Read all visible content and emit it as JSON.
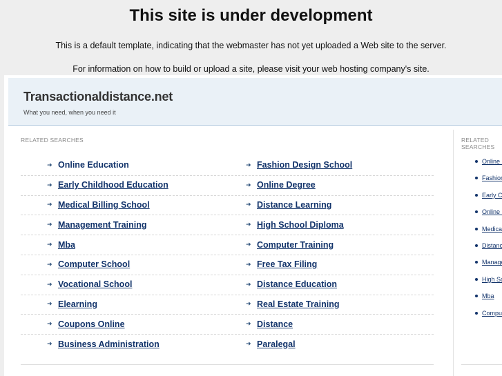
{
  "banner": {
    "title": "This site is under development",
    "line1": "This is a default template, indicating that the webmaster has not yet uploaded a Web site to the server.",
    "line2": "For information on how to build or upload a site, please visit your web hosting company's site."
  },
  "site": {
    "name": "Transactionaldistance.net",
    "tagline": "What you need, when you need it"
  },
  "related": {
    "label": "RELATED SEARCHES",
    "side_label": "RELATED SEARCHES",
    "rows": [
      [
        "Online Education",
        "Fashion Design School"
      ],
      [
        "Early Childhood Education",
        "Online Degree"
      ],
      [
        "Medical Billing School",
        "Distance Learning"
      ],
      [
        "Management Training",
        "High School Diploma"
      ],
      [
        "Mba",
        "Computer Training"
      ],
      [
        "Computer School",
        "Free Tax Filing"
      ],
      [
        "Vocational School",
        "Distance Education"
      ],
      [
        "Elearning",
        "Real Estate Training"
      ],
      [
        "Coupons Online",
        "Distance"
      ],
      [
        "Business Administration",
        "Paralegal"
      ]
    ],
    "side_items": [
      "Online Education",
      "Fashion Design School",
      "Early Childhood Education",
      "Online Degree",
      "Medical Billing School",
      "Distance Learning",
      "Management Training",
      "High School Diploma",
      "Mba",
      "Computer Training"
    ]
  }
}
